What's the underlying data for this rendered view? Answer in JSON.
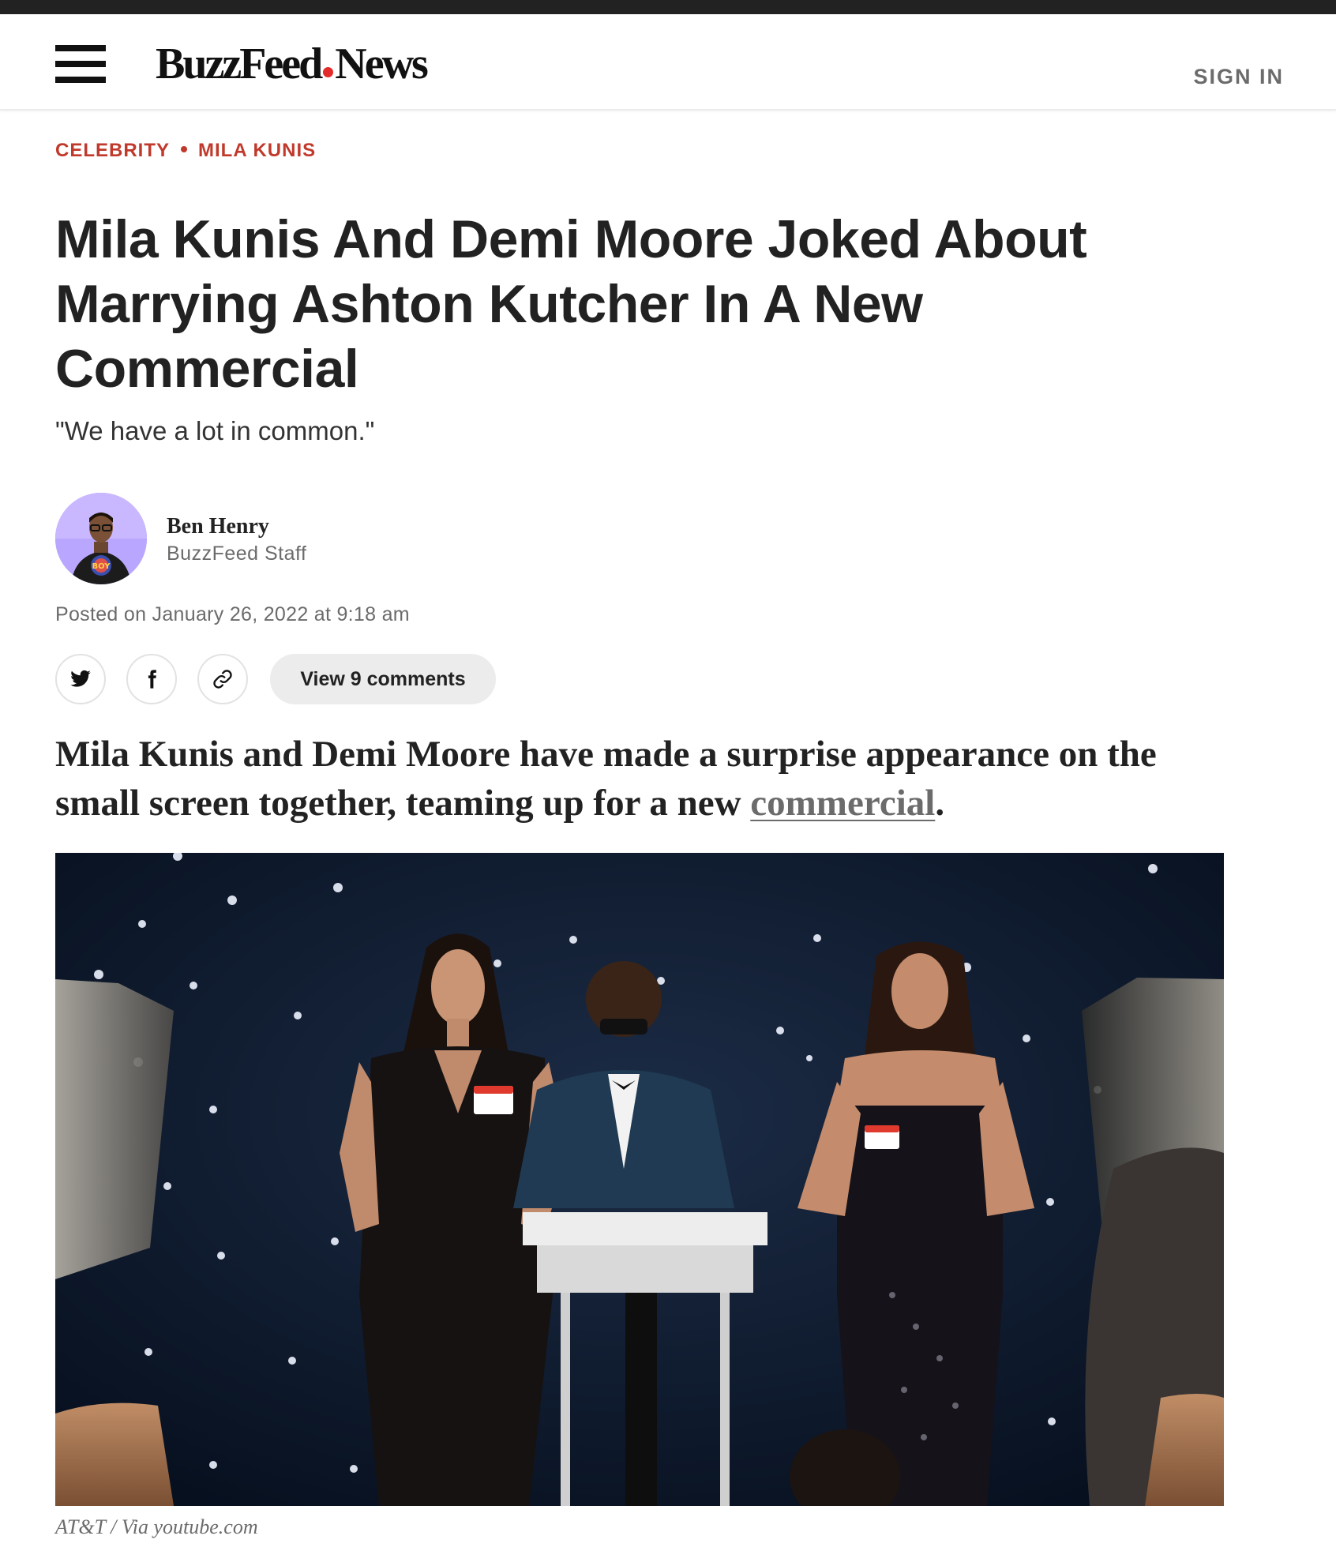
{
  "header": {
    "logo_left": "BuzzFeed",
    "logo_right": "News",
    "sign_in_label": "SIGN IN"
  },
  "breadcrumb": {
    "items": [
      "CELEBRITY",
      "MILA KUNIS"
    ]
  },
  "article": {
    "headline": "Mila Kunis And Demi Moore Joked About Marrying Ashton Kutcher In A New Commercial",
    "dek": "\"We have a lot in common.\"",
    "author": {
      "name": "Ben Henry",
      "role": "BuzzFeed Staff",
      "avatar_shirt_text": "BOY"
    },
    "posted": "Posted on January 26, 2022 at 9:18 am",
    "comments_label": "View 9 comments",
    "lede_text": "Mila Kunis and Demi Moore have made a surprise appearance on the small screen together, teaming up for a new ",
    "lede_link": "commercial",
    "lede_end": ".",
    "image_caption": "AT&T / Via youtube.com"
  },
  "share": {
    "icons": [
      "twitter-icon",
      "facebook-icon",
      "link-icon"
    ]
  },
  "colors": {
    "accent_red": "#c0392b",
    "logo_dot": "#e32b2b",
    "text_dark": "#222222",
    "text_muted": "#6b6b6b"
  }
}
